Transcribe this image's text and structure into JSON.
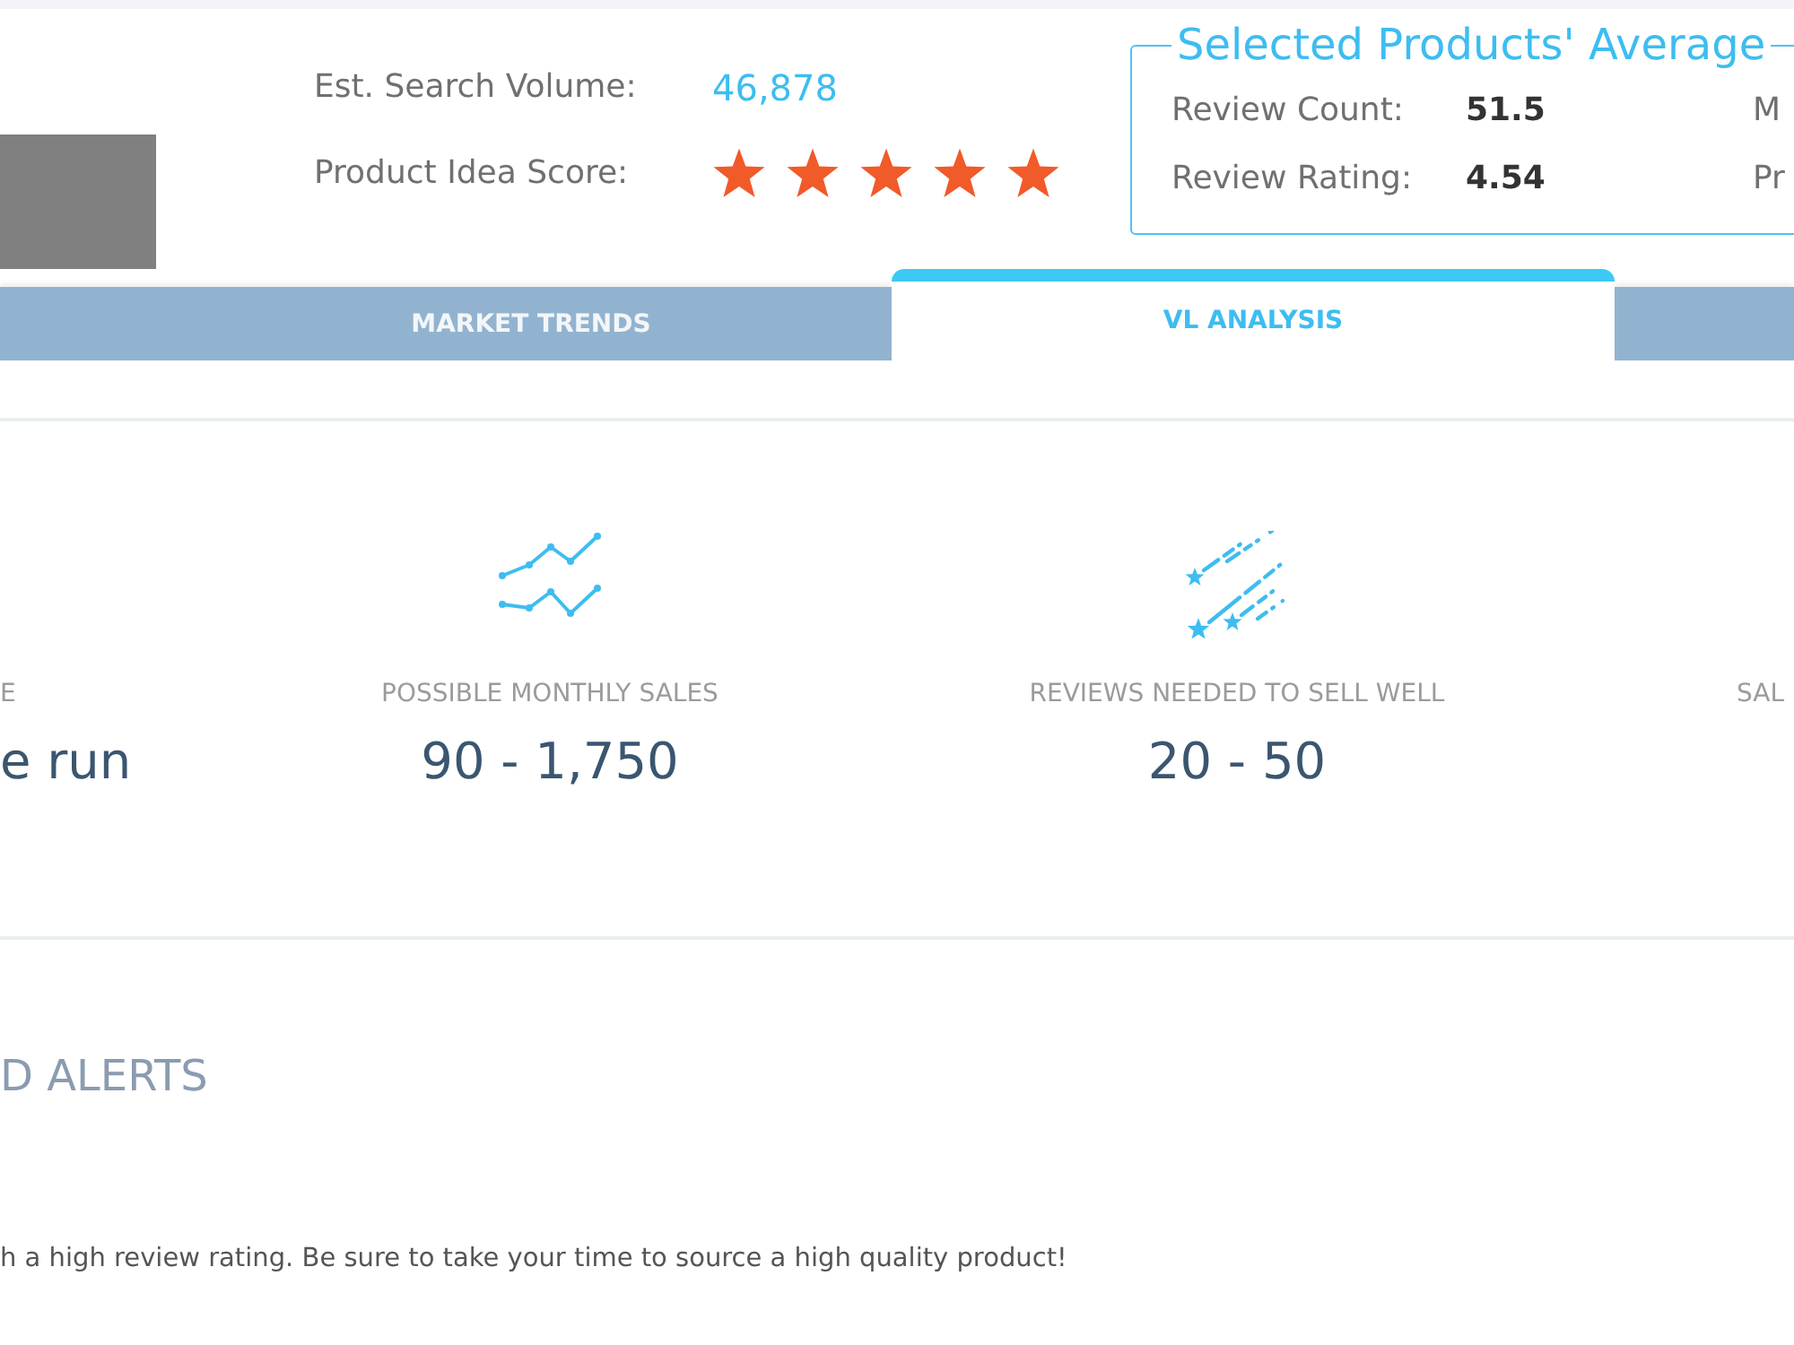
{
  "search_volume": {
    "label": "Est. Search Volume:",
    "value": "46,878"
  },
  "product_idea_score": {
    "label": "Product Idea Score:",
    "stars": 5
  },
  "averages": {
    "title": "Selected Products' Average",
    "columns": [
      {
        "rows": [
          {
            "label": "Review Count:",
            "value": "51.5"
          },
          {
            "label": "Review Rating:",
            "value": "4.54"
          }
        ]
      },
      {
        "rows": [
          {
            "label": "M"
          },
          {
            "label": "Pr"
          }
        ]
      }
    ]
  },
  "tabs": [
    {
      "label": "MARKET TRENDS",
      "selected": false
    },
    {
      "label": "VL ANALYSIS",
      "selected": true
    },
    {
      "selected": false
    }
  ],
  "metrics": [
    {
      "kind": "plain",
      "label": "E",
      "value": "e run"
    },
    {
      "kind": "sales",
      "label": "POSSIBLE MONTHLY SALES",
      "value": "90 - 1,750"
    },
    {
      "kind": "reviews",
      "label": "REVIEWS NEEDED TO SELL WELL",
      "value": "20 - 50"
    },
    {
      "kind": "plain",
      "label": "SAL"
    }
  ],
  "alerts": {
    "title": "D ALERTS",
    "messages": [
      "h a high review rating. Be sure to take your time to source a high quality product!"
    ]
  }
}
